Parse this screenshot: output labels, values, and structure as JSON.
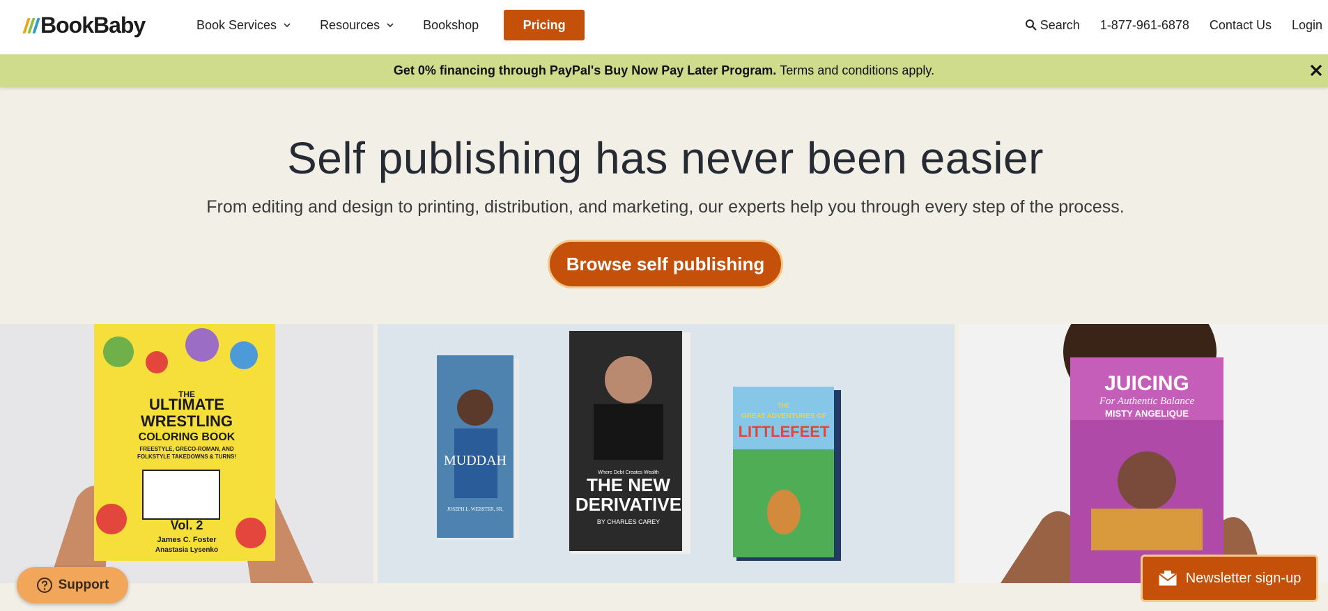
{
  "brand": {
    "name": "BookBaby",
    "colors": {
      "accent": "#c4500a",
      "banner": "#cfdc8c",
      "hero_bg": "#f1efe6"
    }
  },
  "nav": {
    "items": [
      {
        "label": "Book Services",
        "has_dropdown": true
      },
      {
        "label": "Resources",
        "has_dropdown": true
      },
      {
        "label": "Bookshop",
        "has_dropdown": false
      }
    ],
    "pricing_label": "Pricing",
    "search_label": "Search",
    "phone": "1-877-961-6878",
    "contact_label": "Contact Us",
    "login_label": "Login"
  },
  "promo": {
    "bold_text": "Get 0% financing through PayPal's Buy Now Pay Later Program.",
    "text": "Terms and conditions apply.",
    "close_icon": "close-icon"
  },
  "hero": {
    "title": "Self publishing has never been easier",
    "subtitle": "From editing and design to printing, distribution, and marketing, our experts help you through every step of the process.",
    "cta_label": "Browse self publishing"
  },
  "showcase": {
    "left": {
      "book_title_line1": "THE",
      "book_title_line2": "ULTIMATE",
      "book_title_line3": "WRESTLING",
      "book_title_line4": "COLORING BOOK",
      "book_subtitle_line1": "FREESTYLE, GRECO-ROMAN, AND",
      "book_subtitle_line2": "FOLKSTYLE TAKEDOWNS & TURNS!",
      "volume": "Vol. 2",
      "author1": "James C. Foster",
      "author2": "Anastasia Lysenko"
    },
    "mid": {
      "book1_title": "MUDDAH",
      "book1_author": "JOSEPH L. WEBSTER, SR.",
      "book2_tagline": "Where Debt Creates Wealth",
      "book2_title_line1": "THE NEW",
      "book2_title_line2": "DERIVATIVE",
      "book2_author": "BY CHARLES CAREY",
      "book3_title_line1": "THE",
      "book3_title_line2": "GREAT ADVENTURES OF",
      "book3_title_line3": "LITTLEFEET"
    },
    "right": {
      "book_title": "JUICING",
      "book_subtitle": "For Authentic Balance",
      "book_author": "MISTY ANGELIQUE"
    }
  },
  "floating": {
    "support_label": "Support",
    "newsletter_label": "Newsletter sign-up"
  }
}
